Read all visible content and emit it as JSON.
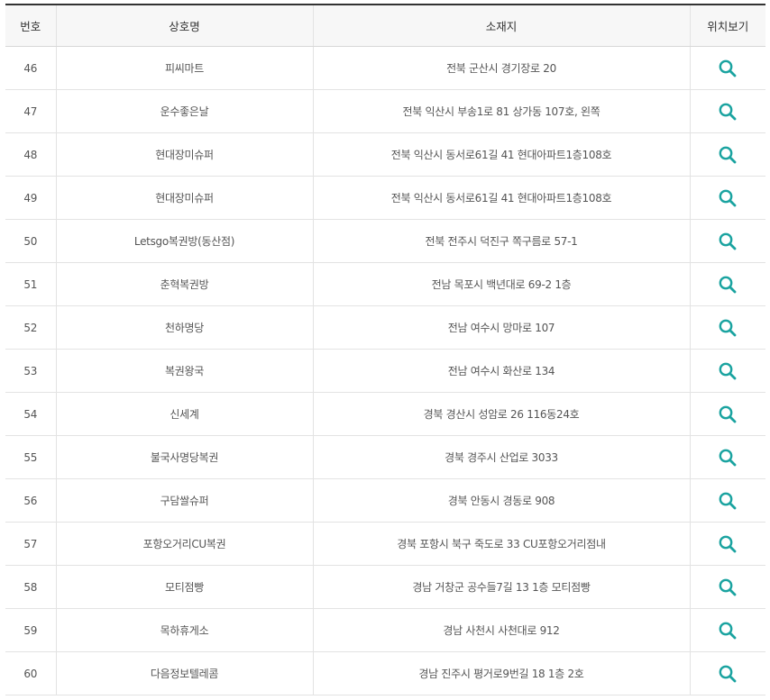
{
  "table": {
    "headers": {
      "number": "번호",
      "name": "상호명",
      "address": "소재지",
      "location": "위치보기"
    },
    "accent_color": "#1aa3a0",
    "map_icon": "search-icon",
    "rows": [
      {
        "number": "46",
        "name": "피씨마트",
        "address": "전북 군산시 경기장로 20"
      },
      {
        "number": "47",
        "name": "운수좋은날",
        "address": "전북 익산시 부송1로 81 상가동 107호, 왼쪽"
      },
      {
        "number": "48",
        "name": "현대장미슈퍼",
        "address": "전북 익산시 동서로61길 41 현대아파트1층108호"
      },
      {
        "number": "49",
        "name": "현대장미슈퍼",
        "address": "전북 익산시 동서로61길 41 현대아파트1층108호"
      },
      {
        "number": "50",
        "name": "Letsgo복권방(동산점)",
        "address": "전북 전주시 덕진구 쪽구름로 57-1"
      },
      {
        "number": "51",
        "name": "춘혁복권방",
        "address": "전남 목포시 백년대로 69-2 1층"
      },
      {
        "number": "52",
        "name": "천하명당",
        "address": "전남 여수시 망마로 107"
      },
      {
        "number": "53",
        "name": "복권왕국",
        "address": "전남 여수시 화산로 134"
      },
      {
        "number": "54",
        "name": "신세계",
        "address": "경북 경산시 성암로 26 116동24호"
      },
      {
        "number": "55",
        "name": "불국사명당복권",
        "address": "경북 경주시 산업로 3033"
      },
      {
        "number": "56",
        "name": "구담쌀슈퍼",
        "address": "경북 안동시 경동로 908"
      },
      {
        "number": "57",
        "name": "포항오거리CU복권",
        "address": "경북 포항시 북구 죽도로 33 CU포항오거리점내"
      },
      {
        "number": "58",
        "name": "모티점빵",
        "address": "경남 거창군 공수들7길 13 1층 모티점빵"
      },
      {
        "number": "59",
        "name": "목하휴게소",
        "address": "경남 사천시 사천대로 912"
      },
      {
        "number": "60",
        "name": "다음정보텔레콤",
        "address": "경남 진주시 평거로9번길 18 1층 2호"
      }
    ]
  }
}
